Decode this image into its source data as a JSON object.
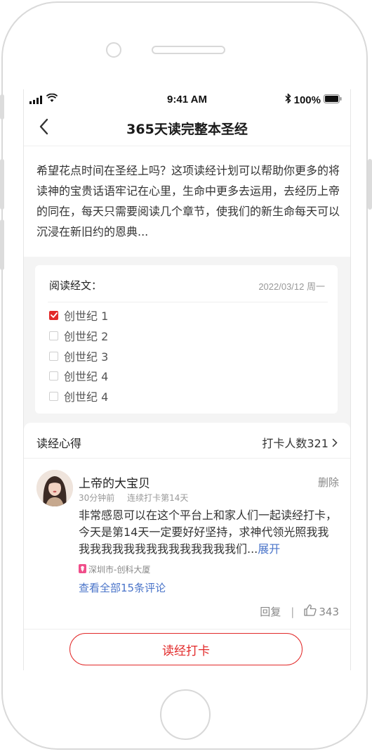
{
  "status_bar": {
    "time": "9:41 AM",
    "battery": "100%"
  },
  "nav": {
    "title": "365天读完整本圣经"
  },
  "intro": {
    "text": "希望花点时间在圣经上吗？这项读经计划可以帮助你更多的将读神的宝贵话语牢记在心里，生命中更多去运用，去经历上帝的同在，每天只需要阅读几个章节，使我们的新生命每天可以沉浸在新旧约的恩典..."
  },
  "reading": {
    "label": "阅读经文：",
    "date": "2022/03/12 周一",
    "chapters": [
      {
        "label": "创世纪 1",
        "checked": true
      },
      {
        "label": "创世纪 2",
        "checked": false
      },
      {
        "label": "创世纪 3",
        "checked": false
      },
      {
        "label": "创世纪 4",
        "checked": false
      },
      {
        "label": "创世纪 4",
        "checked": false
      }
    ]
  },
  "journal": {
    "title": "读经心得",
    "checkin_count": "打卡人数321",
    "post": {
      "user": "上帝的大宝贝",
      "delete_label": "删除",
      "time_ago": "30分钟前",
      "streak": "连续打卡第14天",
      "content": "非常感恩可以在这个平台上和家人们一起读经打卡，今天是第14天一定要好好坚持，求神代领光照我我我我我我我我我我我我我我我我们...",
      "expand_label": "展开",
      "location": "深圳市-创科大厦",
      "view_comments": "查看全部15条评论",
      "reply_label": "回复",
      "separator": "|",
      "likes": "343"
    }
  },
  "cta": {
    "label": "读经打卡"
  },
  "colors": {
    "accent": "#e22a2a",
    "link": "#4a74c9"
  },
  "icons": [
    "signal-icon",
    "wifi-icon",
    "bluetooth-icon",
    "battery-icon",
    "back-icon",
    "checkbox-icon",
    "location-pin-icon",
    "chevron-right-icon",
    "thumbs-up-icon"
  ]
}
